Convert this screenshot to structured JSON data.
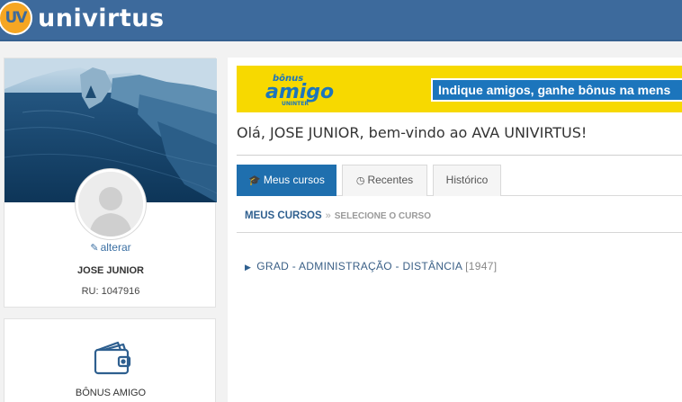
{
  "header": {
    "logo_mark": "UV",
    "brand": "univirtus"
  },
  "profile": {
    "edit_label": "alterar",
    "name": "JOSE JUNIOR",
    "ru": "RU: 1047916"
  },
  "bonus_card": {
    "label": "BÔNUS AMIGO"
  },
  "banner": {
    "logo_top": "bônus",
    "logo_main": "amigo",
    "logo_sub": "UNINTER",
    "text": "Indique amigos, ganhe bônus na mens"
  },
  "welcome": "Olá, JOSE JUNIOR, bem-vindo ao AVA UNIVIRTUS!",
  "tabs": [
    {
      "label": "Meus cursos",
      "icon": "graduation-cap-icon",
      "active": true
    },
    {
      "label": "Recentes",
      "icon": "clock-icon",
      "active": false
    },
    {
      "label": "Histórico",
      "active": false
    }
  ],
  "breadcrumb": {
    "main": "MEUS CURSOS",
    "separator": "»",
    "sub": "SELECIONE O CURSO"
  },
  "courses": [
    {
      "name": "GRAD - ADMINISTRAÇÃO - DISTÂNCIA",
      "code": "[1947]"
    }
  ],
  "colors": {
    "header": "#3d6a9c",
    "accent": "#1f6fae",
    "logo_orange": "#f5a623",
    "banner_yellow": "#f7d900"
  }
}
